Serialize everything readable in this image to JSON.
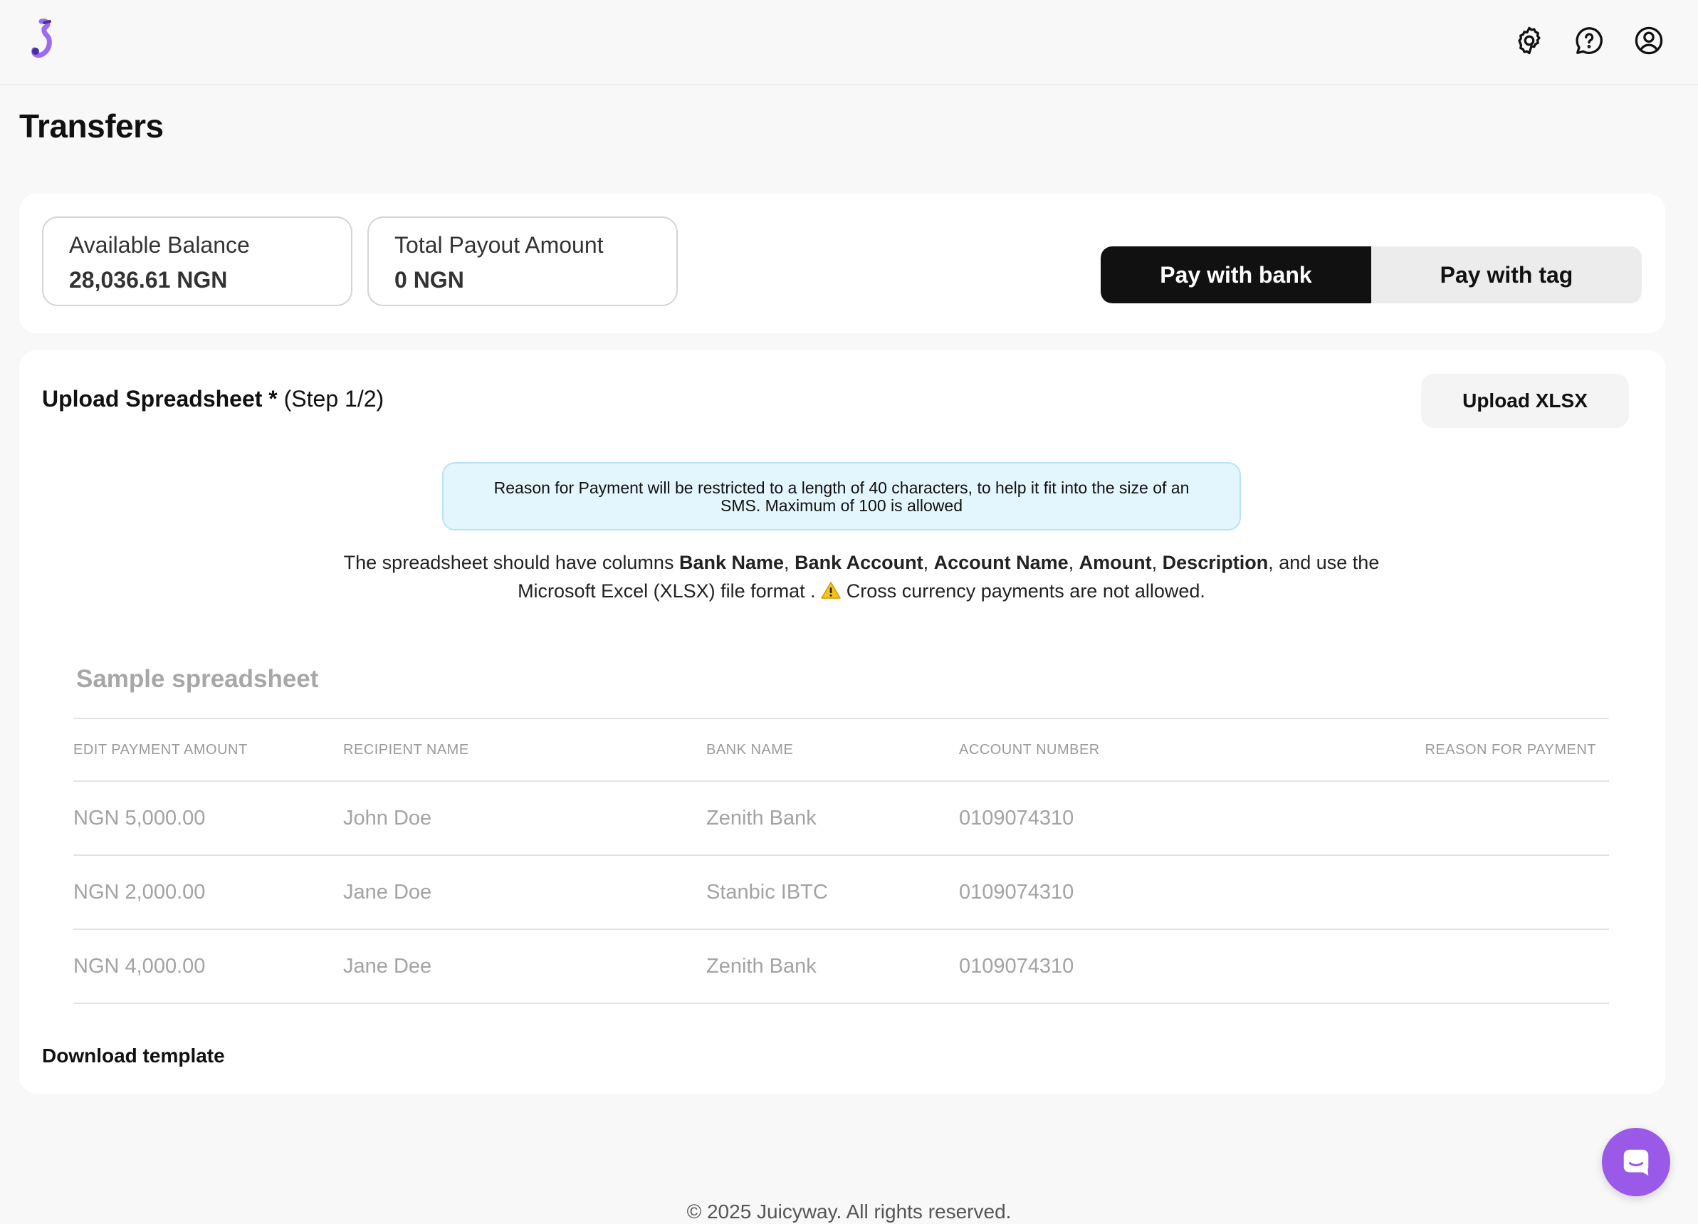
{
  "header": {
    "logo_icon": "juicyway-logo",
    "icons": [
      "gear-icon",
      "help-chat-icon",
      "user-account-icon"
    ]
  },
  "page": {
    "title": "Transfers"
  },
  "summary": {
    "available_balance_label": "Available Balance",
    "available_balance_value": "28,036.61 NGN",
    "total_payout_label": "Total Payout Amount",
    "total_payout_value": "0 NGN"
  },
  "pay_toggle": {
    "bank_label": "Pay with bank",
    "tag_label": "Pay with tag",
    "selected": "Pay with bank"
  },
  "upload": {
    "title_bold": "Upload Spreadsheet *",
    "title_step": "(Step 1/2)",
    "upload_button": "Upload XLSX",
    "notice": "Reason for Payment will be restricted to a length of 40 characters, to help it fit into the size of an SMS. Maximum of 100 is allowed",
    "instructions": {
      "prefix": "The spreadsheet should have columns",
      "col1": "Bank Name",
      "col2": "Bank Account",
      "col3": "Account Name",
      "col4": "Amount",
      "col5": "Description",
      "suffix": "and use the Microsoft Excel (XLSX) file format .",
      "warning": "Cross currency payments are not allowed."
    }
  },
  "sample": {
    "title": "Sample spreadsheet",
    "columns": [
      "EDIT PAYMENT AMOUNT",
      "RECIPIENT NAME",
      "BANK NAME",
      "ACCOUNT NUMBER",
      "REASON FOR PAYMENT"
    ],
    "rows": [
      [
        "NGN 5,000.00",
        "John Doe",
        "Zenith Bank",
        "0109074310",
        ""
      ],
      [
        "NGN 2,000.00",
        "Jane Doe",
        "Stanbic IBTC",
        "0109074310",
        ""
      ],
      [
        "NGN 4,000.00",
        "Jane Dee",
        "Zenith Bank",
        "0109074310",
        ""
      ]
    ],
    "download_label": "Download template"
  },
  "chat": {
    "icon": "chat-bubble-icon",
    "color": "#9b59e8"
  },
  "footer": {
    "text": "© 2025 Juicyway. All rights reserved."
  }
}
